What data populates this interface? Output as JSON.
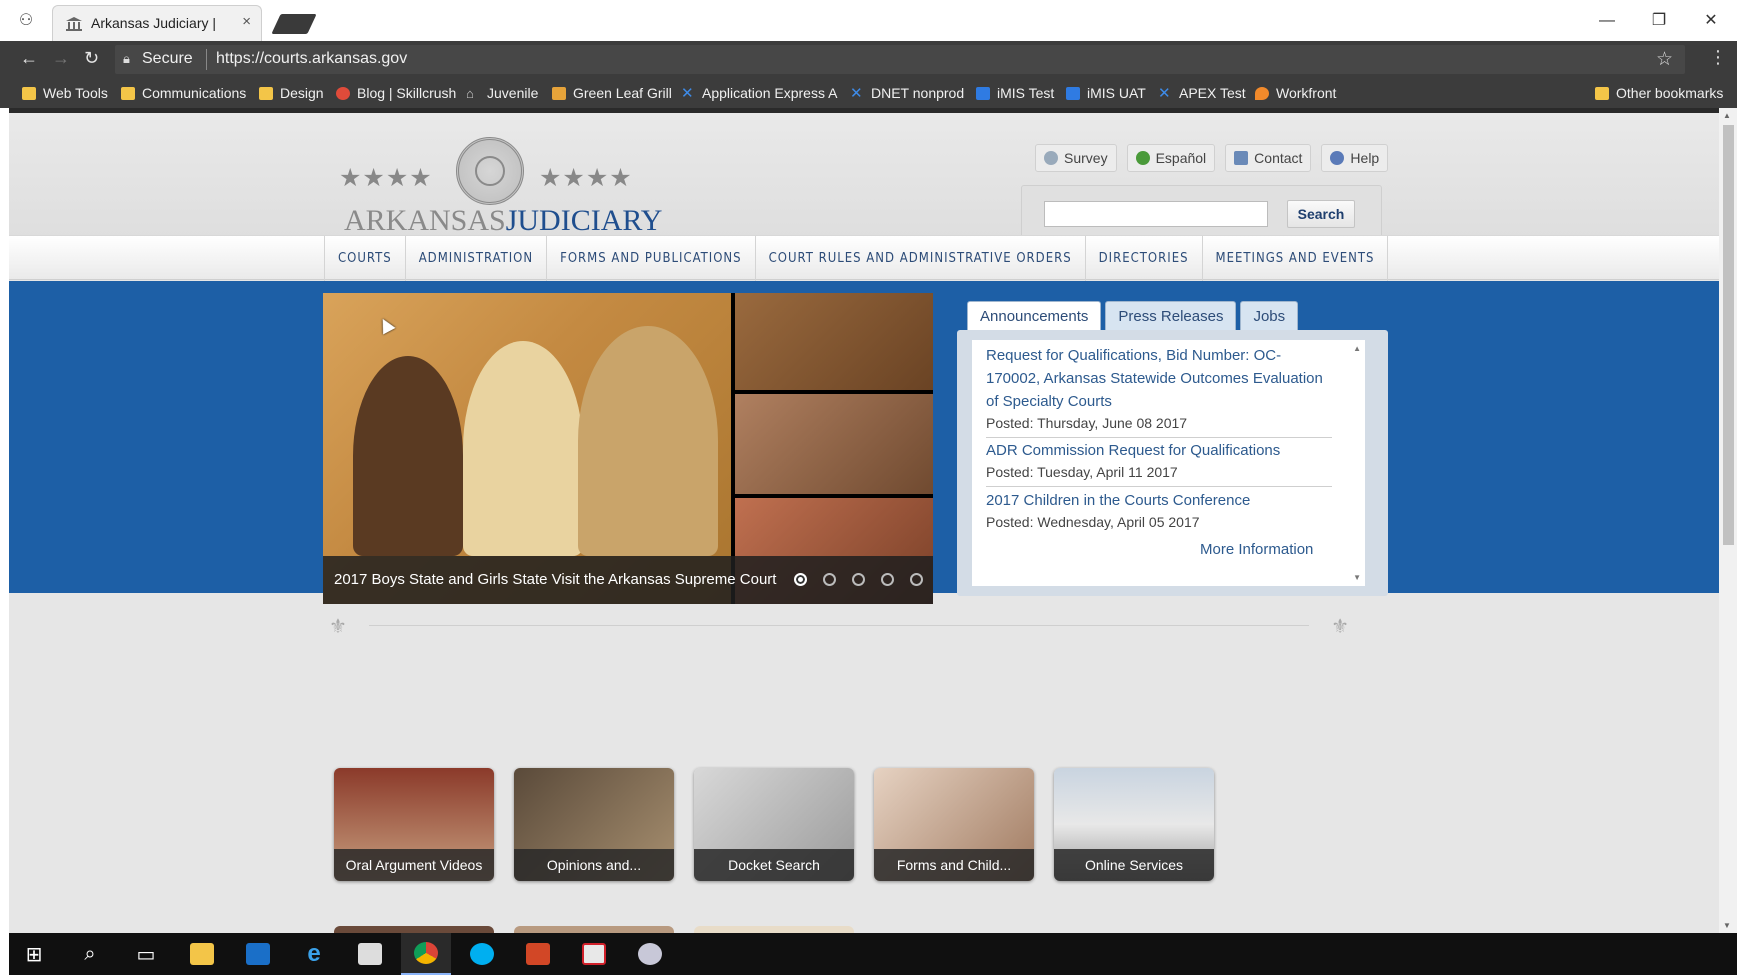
{
  "browser": {
    "tab_title": "Arkansas Judiciary |",
    "close_glyph": "×",
    "secure_label": "Secure",
    "url": "https://courts.arkansas.gov",
    "bookmarks": [
      {
        "label": "Web Tools",
        "icon": "folder"
      },
      {
        "label": "Communications",
        "icon": "folder"
      },
      {
        "label": "Design",
        "icon": "folder"
      },
      {
        "label": "Blog | Skillcrush",
        "icon": "blog"
      },
      {
        "label": "Juvenile",
        "icon": "juv"
      },
      {
        "label": "Green Leaf Grill",
        "icon": "leaf"
      },
      {
        "label": "Application Express A",
        "icon": "apex"
      },
      {
        "label": "DNET nonprod",
        "icon": "apex"
      },
      {
        "label": "iMIS Test",
        "icon": "imis"
      },
      {
        "label": "iMIS UAT",
        "icon": "imis"
      },
      {
        "label": "APEX Test",
        "icon": "apex"
      },
      {
        "label": "Workfront",
        "icon": "wf"
      }
    ],
    "other_bookmarks": "Other bookmarks"
  },
  "site": {
    "logo_left": "ARKANSAS",
    "logo_right": "JUDICIARY",
    "util_links": [
      "Survey",
      "Español",
      "Contact",
      "Help"
    ],
    "search_button": "Search",
    "nav": [
      "COURTS",
      "ADMINISTRATION",
      "FORMS AND PUBLICATIONS",
      "COURT RULES AND ADMINISTRATIVE ORDERS",
      "DIRECTORIES",
      "MEETINGS AND EVENTS"
    ],
    "slider_caption": "2017 Boys State and Girls State Visit the Arkansas Supreme Court",
    "slider_dots": 5,
    "slider_active_dot": 1,
    "news_tabs": [
      "Announcements",
      "Press Releases",
      "Jobs"
    ],
    "news_active_tab": "Announcements",
    "announcements": [
      {
        "title": "Request for Qualifications, Bid Number: OC-170002, Arkansas Statewide Outcomes Evaluation of Specialty Courts",
        "posted": "Posted: Thursday, June 08 2017"
      },
      {
        "title": "ADR Commission Request for Qualifications",
        "posted": "Posted: Tuesday, April 11 2017"
      },
      {
        "title": "2017 Children in the Courts Conference",
        "posted": "Posted: Wednesday, April 05 2017"
      }
    ],
    "more_info": "More Information",
    "quick_links": [
      "Oral Argument Videos",
      "Opinions and...",
      "Docket Search",
      "Forms and Child...",
      "Online Services"
    ]
  },
  "colors": {
    "brand_blue": "#1d5fa6",
    "nav_text": "#2d4c78",
    "link_blue": "#2d5a8e"
  },
  "taskbar_icons": [
    "windows-start",
    "search",
    "task-view",
    "file-explorer",
    "outlook",
    "internet-explorer",
    "calculator",
    "chrome",
    "skype",
    "powerpoint",
    "acrobat",
    "snipping-tool"
  ]
}
